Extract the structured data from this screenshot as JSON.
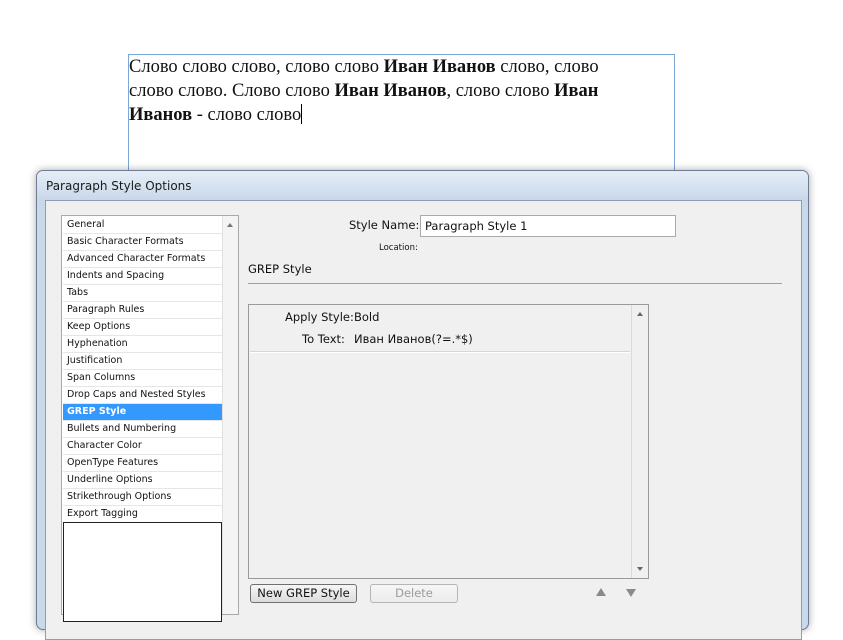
{
  "document": {
    "line1_a": "Слово слово слово, слово слово ",
    "line1_b": "Иван Иванов",
    "line1_c": " слово, слово",
    "line2_a": "слово слово. Слово слово ",
    "line2_b": "Иван Иванов",
    "line2_c": ", слово слово ",
    "line2_d": "Иван",
    "line3_a": "Иванов",
    "line3_b": " - слово слово"
  },
  "dialog": {
    "title": "Paragraph Style Options",
    "categories": [
      "General",
      "Basic Character Formats",
      "Advanced Character Formats",
      "Indents and Spacing",
      "Tabs",
      "Paragraph Rules",
      "Keep Options",
      "Hyphenation",
      "Justification",
      "Span Columns",
      "Drop Caps and Nested Styles",
      "GREP Style",
      "Bullets and Numbering",
      "Character Color",
      "OpenType Features",
      "Underline Options",
      "Strikethrough Options",
      "Export Tagging"
    ],
    "selected_category": "GREP Style",
    "style_name_label": "Style Name:",
    "style_name_value": "Paragraph Style 1",
    "location_label": "Location:",
    "section_title": "GREP Style",
    "grep": {
      "apply_style_label": "Apply Style:",
      "apply_style_value": "Bold",
      "to_text_label": "To Text:",
      "to_text_value": "Иван Иванов(?=.*$)"
    },
    "new_grep_button": "New GREP Style",
    "delete_button": "Delete"
  }
}
